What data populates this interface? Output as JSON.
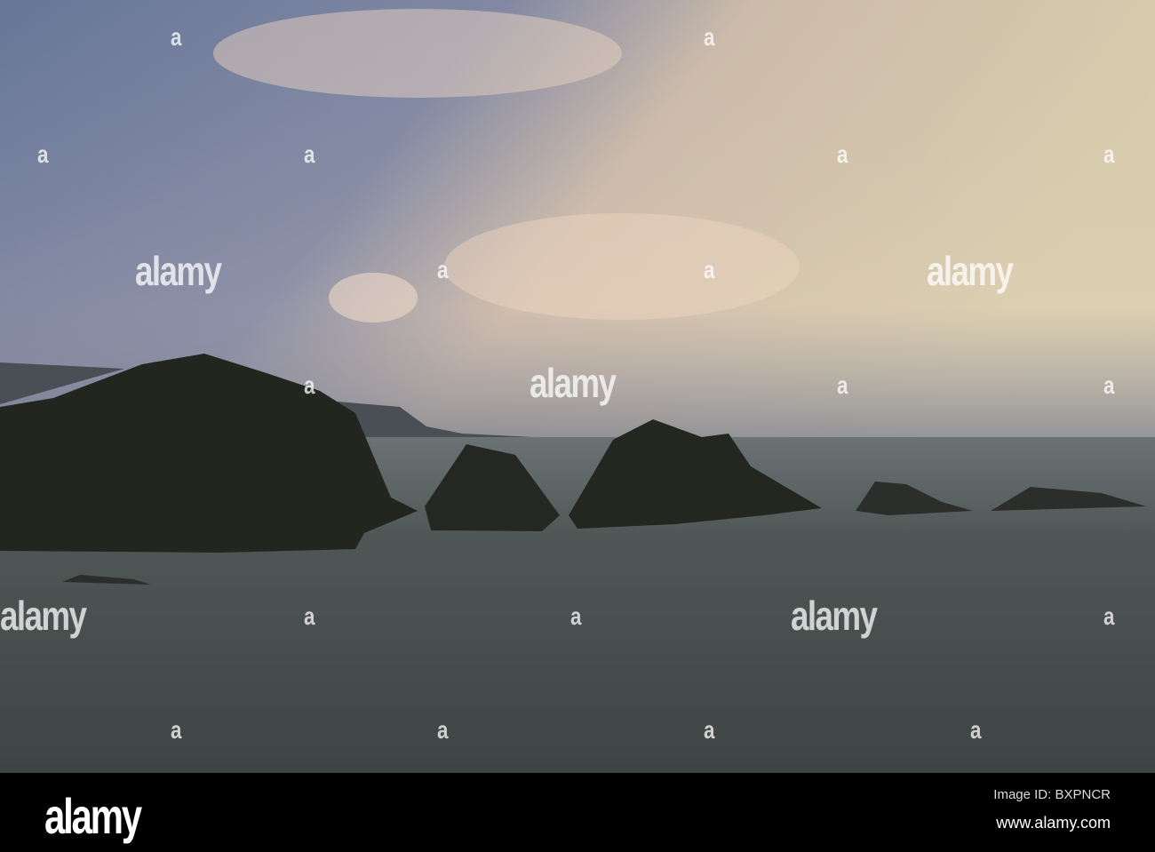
{
  "watermark": {
    "text": "alamy",
    "small_text": "a"
  },
  "footer": {
    "logo": "alamy",
    "image_id": "Image ID: BXPNCR",
    "website": "www.alamy.com"
  },
  "colors": {
    "sky_left": "#6c7b9a",
    "sky_right": "#f6e2b2",
    "sea": "#4b5251",
    "rock": "#222520"
  }
}
